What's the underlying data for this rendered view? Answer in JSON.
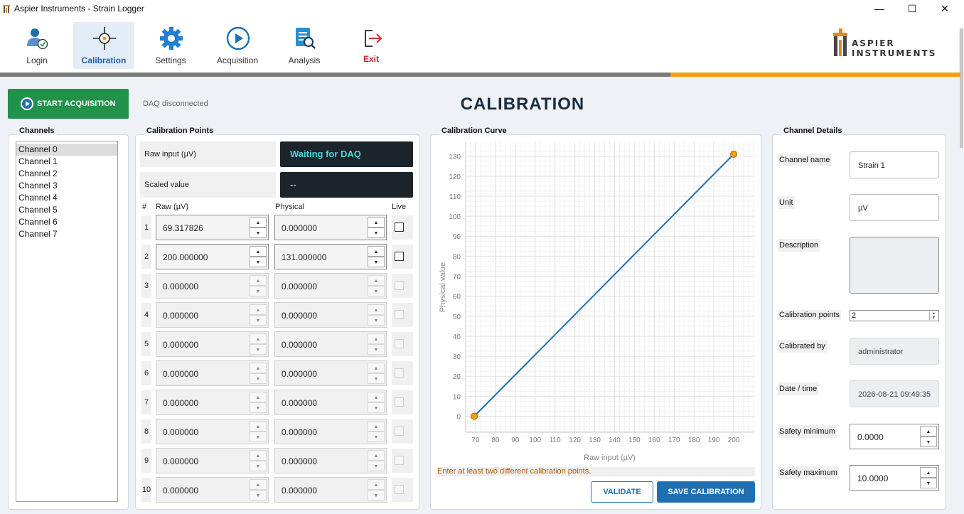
{
  "window": {
    "title": "Aspier Instruments - Strain Logger",
    "minimize": "—",
    "maximize": "☐",
    "close": "✕"
  },
  "toolbar": {
    "login": "Login",
    "calibration": "Calibration",
    "settings": "Settings",
    "acquisition": "Acquisition",
    "analysis": "Analysis",
    "exit": "Exit",
    "active": "calibration"
  },
  "logo": {
    "line1": "ASPIER",
    "line2": "INSTRUMENTS"
  },
  "header": {
    "start_label": "START ACQUISITION",
    "daq_status": "DAQ disconnected",
    "page_title": "CALIBRATION"
  },
  "channels": {
    "title": "Channels",
    "items": [
      "Channel 0",
      "Channel 1",
      "Channel 2",
      "Channel 3",
      "Channel 4",
      "Channel 5",
      "Channel 6",
      "Channel 7"
    ],
    "selected": "Channel 0"
  },
  "calibration_points": {
    "title": "Calibration Points",
    "raw_input_label": "Raw input (µV)",
    "raw_input_value": "Waiting for DAQ",
    "scaled_label": "Scaled value",
    "scaled_value": "--",
    "headers": {
      "num": "#",
      "raw": "Raw (µV)",
      "physical": "Physical",
      "live": "Live"
    },
    "rows": [
      {
        "n": "1",
        "raw": "69.317826",
        "physical": "0.000000",
        "enabled": true
      },
      {
        "n": "2",
        "raw": "200.000000",
        "physical": "131.000000",
        "enabled": true
      },
      {
        "n": "3",
        "raw": "0.000000",
        "physical": "0.000000",
        "enabled": false
      },
      {
        "n": "4",
        "raw": "0.000000",
        "physical": "0.000000",
        "enabled": false
      },
      {
        "n": "5",
        "raw": "0.000000",
        "physical": "0.000000",
        "enabled": false
      },
      {
        "n": "6",
        "raw": "0.000000",
        "physical": "0.000000",
        "enabled": false
      },
      {
        "n": "7",
        "raw": "0.000000",
        "physical": "0.000000",
        "enabled": false
      },
      {
        "n": "8",
        "raw": "0.000000",
        "physical": "0.000000",
        "enabled": false
      },
      {
        "n": "9",
        "raw": "0.000000",
        "physical": "0.000000",
        "enabled": false
      },
      {
        "n": "10",
        "raw": "0.000000",
        "physical": "0.000000",
        "enabled": false
      }
    ]
  },
  "curve": {
    "title": "Calibration Curve",
    "warning": "Enter at least two different calibration points.",
    "validate": "VALIDATE",
    "save": "SAVE CALIBRATION"
  },
  "chart_data": {
    "type": "line",
    "xlabel": "Raw input (µV)",
    "ylabel": "Physical value",
    "xlim": [
      65,
      210
    ],
    "ylim": [
      -8,
      137
    ],
    "xticks": [
      70,
      80,
      90,
      100,
      110,
      120,
      130,
      140,
      150,
      160,
      170,
      180,
      190,
      200
    ],
    "yticks": [
      0,
      10,
      20,
      30,
      40,
      50,
      60,
      70,
      80,
      90,
      100,
      110,
      120,
      130
    ],
    "grid": true,
    "series": [
      {
        "x": [
          69.317826,
          200.0
        ],
        "y": [
          0.0,
          131.0
        ]
      }
    ],
    "line_color": "#1f6fb2",
    "marker_color": "#f0a20f"
  },
  "details": {
    "title": "Channel Details",
    "channel_name_label": "Channel name",
    "channel_name": "Strain 1",
    "unit_label": "Unit",
    "unit": "µV",
    "description_label": "Description",
    "description": "",
    "points_label": "Calibration points",
    "points": "2",
    "calibrated_by_label": "Calibrated by",
    "calibrated_by": "administrator",
    "datetime_label": "Date / time",
    "datetime": "2026-08-21 09:49:35",
    "safety_min_label": "Safety minimum",
    "safety_min": "0.0000",
    "safety_max_label": "Safety maximum",
    "safety_max": "10.0000"
  },
  "colors": {
    "accent": "#1f6fb2",
    "start_green": "#22924a",
    "progress": "#f0a20f",
    "exit_red": "#c0262d",
    "daq_text": "#4fd6e0"
  }
}
